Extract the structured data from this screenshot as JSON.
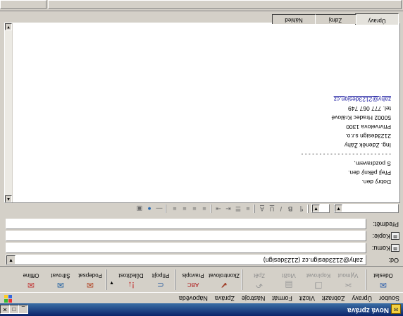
{
  "window": {
    "title": "Nová zpráva",
    "buttons": [
      "_",
      "□",
      "✕"
    ]
  },
  "menu": [
    "Soubor",
    "Úpravy",
    "Zobrazit",
    "Vložit",
    "Formát",
    "Nástroje",
    "Zpráva",
    "Nápověda"
  ],
  "toolbar": {
    "buttons": [
      {
        "label": "Odeslat",
        "icon": "send-icon",
        "enabled": true
      },
      {
        "label": "Vyjmout",
        "icon": "scissors-icon",
        "enabled": false
      },
      {
        "label": "Kopírovat",
        "icon": "copy-icon",
        "enabled": false
      },
      {
        "label": "Vložit",
        "icon": "paste-icon",
        "enabled": false
      },
      {
        "label": "Zpět",
        "icon": "undo-icon",
        "enabled": false
      },
      {
        "label": "Zkontrolovat",
        "icon": "check-names-icon",
        "enabled": true
      },
      {
        "label": "Pravopis",
        "icon": "spelling-icon",
        "enabled": true
      },
      {
        "label": "Připojit",
        "icon": "paperclip-icon",
        "enabled": true
      },
      {
        "label": "Důležitost",
        "icon": "priority-icon",
        "enabled": true
      },
      {
        "label": "Podepsat",
        "icon": "sign-icon",
        "enabled": true
      },
      {
        "label": "Šifrovat",
        "icon": "encrypt-icon",
        "enabled": true
      },
      {
        "label": "Offline",
        "icon": "offline-icon",
        "enabled": true
      }
    ]
  },
  "header": {
    "from_label": "Od:",
    "from_value": "zahy@2123design.cz   (2123design)",
    "to_label": "Komu:",
    "to_value": "",
    "cc_label": "Kopie:",
    "cc_value": "",
    "subject_label": "Předmět:",
    "subject_value": ""
  },
  "format_bar": {
    "buttons": [
      "B",
      "I",
      "U",
      "A"
    ]
  },
  "message_body": {
    "lines": [
      "Dobrý den.",
      "",
      "",
      "Přeji pěkný den.",
      "",
      "S pozdravem,",
      "",
      "- - - - - - - - - - - - - - - - - - - - - - - - -",
      "Ing. Zdeněk Žáhy",
      "2123design s.r.o.",
      "Přívrvelova 1300",
      "50002 Hradec Králové",
      "tel. 777 067 749"
    ],
    "email": "zahy@2123design.cz"
  },
  "tabs": [
    {
      "label": "Úpravy",
      "active": true
    },
    {
      "label": "Zdroj",
      "active": false
    },
    {
      "label": "Náhled",
      "active": false
    }
  ]
}
